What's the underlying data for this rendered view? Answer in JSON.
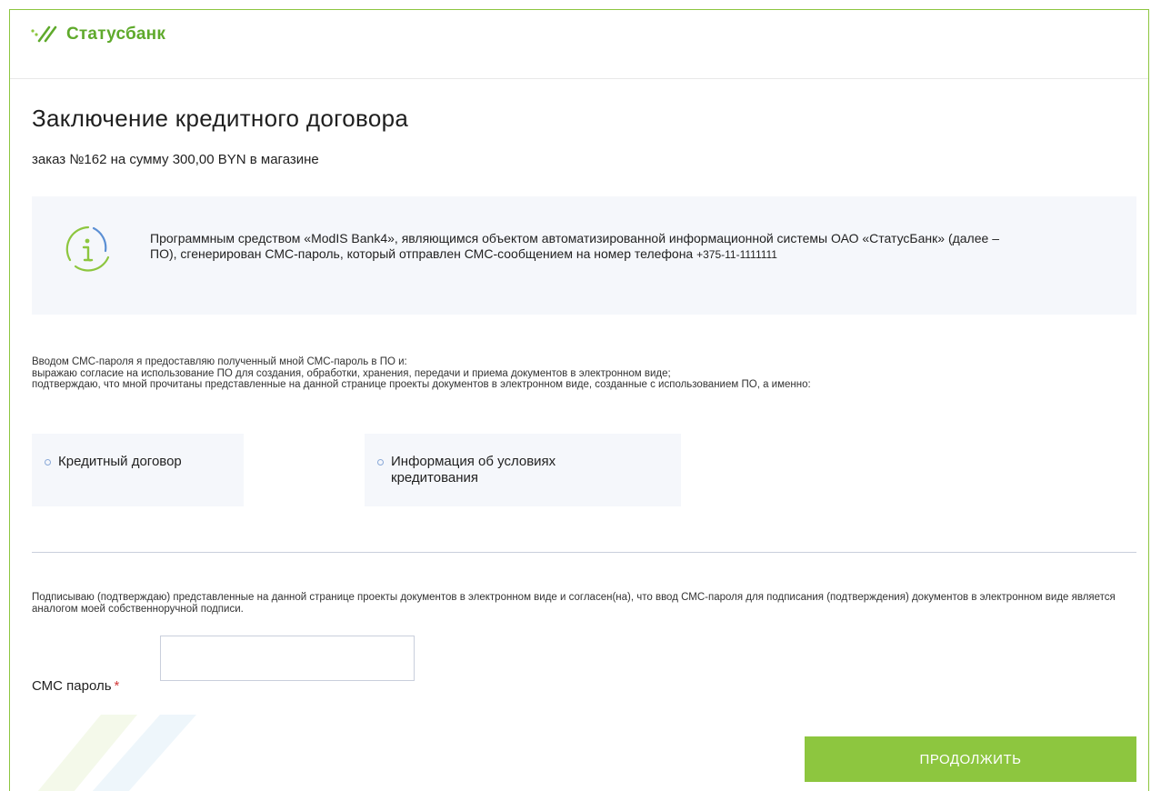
{
  "brand": {
    "name": "Статусбанк",
    "color": "#5faa2c",
    "accent": "#8dc63f"
  },
  "page": {
    "title": "Заключение кредитного договора",
    "order_line": "заказ №162 на сумму 300,00 BYN в магазине"
  },
  "info": {
    "icon": "info-icon",
    "text_prefix": "Программным средством «ModIS Bank4», являющимся объектом автоматизированной информационной системы ОАО «СтатусБанк» (далее – ПО), сгенерирован СМС-пароль, который отправлен СМС-сообщением на номер телефона ",
    "phone": "+375-11-1111111"
  },
  "consent": {
    "lines": [
      "Вводом СМС-пароля я предоставляю полученный мной СМС-пароль в ПО и:",
      "выражаю согласие на использование ПО для создания, обработки, хранения, передачи и приема документов в электронном виде;",
      "подтверждаю, что мной прочитаны представленные на данной странице проекты документов в электронном виде, созданные с использованием ПО, а именно:"
    ]
  },
  "documents": [
    {
      "label": "Кредитный договор"
    },
    {
      "label": "Информация об условиях кредитования"
    }
  ],
  "signature_text": "Подписываю (подтверждаю) представленные на данной странице проекты документов в электронном виде и согласен(на), что ввод СМС-пароля для подписания (подтверждения) документов в электронном виде является аналогом моей собственноручной подписи.",
  "sms": {
    "label": "СМС пароль",
    "required_mark": "*",
    "value": "",
    "placeholder": ""
  },
  "actions": {
    "continue_label": "ПРОДОЛЖИТЬ"
  }
}
